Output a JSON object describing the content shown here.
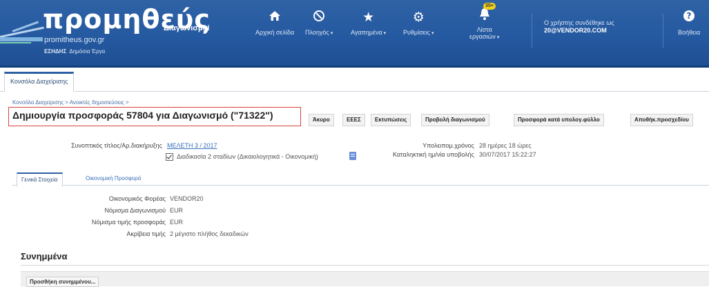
{
  "header": {
    "logo_text": "προμηθεύς",
    "logo_subtitle": "Διαγωνισμοί",
    "logo_url": "promitheus.gov.gr",
    "logo_tag_bold": "ΕΣΗΔΗΣ",
    "logo_tag": "Δημόσια Έργα",
    "nav": {
      "home": "Αρχική σελίδα",
      "navigation": "Πλοηγός",
      "favorites": "Αγαπημένα",
      "settings": "Ρυθμίσεις",
      "worklist_line1": "Λίστα",
      "worklist_line2": "εργασιών",
      "worklist_badge": "35+",
      "help": "Βοήθεια"
    },
    "user_line1": "Ο χρήστης συνδέθηκε ως",
    "user_line2": "20@VENDOR20.COM"
  },
  "tabs": {
    "console": "Κονσόλα Διαχείρισης"
  },
  "breadcrumb": "Κονσόλα Διαχείρισης  >  Ανοικτές δημοσιεύσεις  >",
  "page_title": "Δημιουργία προσφοράς 57804 για Διαγωνισμό (\"71322\")",
  "actions": {
    "cancel": "Άκυρο",
    "eeee": "ΕΕΕΣ",
    "print": "Εκτυπώσεις",
    "view": "Προβολή διαγωνισμού",
    "spreadsheet": "Προσφορά κατά υπολογ.φύλλο",
    "save_draft": "Αποθήκ.προσχεδίου"
  },
  "summary": {
    "ref_label": "Συνοπτικός τίτλος/Αρ.διακήρυξης",
    "ref_value": "ΜΕΛΕΤΗ 3 / 2017",
    "two_stage": "Διαδικασία 2 σταδίων (Δικαιολογητικά - Οικονομική)",
    "remaining_label": "Υπολειπομ.χρόνος",
    "remaining_value": "28 ημέρες 18 ώρες",
    "deadline_label": "Καταληκτική ημ/νία υποβολής",
    "deadline_value": "30/07/2017 15:22:27"
  },
  "subtabs": {
    "general": "Γενικά Στοιχεία",
    "financial": "Οικονομική Προσφορά"
  },
  "general": {
    "operator_label": "Οικονομικός Φορέας",
    "operator_value": "VENDOR20",
    "tender_currency_label": "Νόμισμα Διαγωνισμού",
    "tender_currency_value": "EUR",
    "offer_currency_label": "Νόμισμα τιμής προσφοράς",
    "offer_currency_value": "EUR",
    "precision_label": "Ακρίβεια τιμής",
    "precision_value": "2 μέγιστο πλήθος δεκαδικών"
  },
  "attachments": {
    "title": "Συνημμένα",
    "add_button": "Προσθήκη συνημμένου..."
  }
}
